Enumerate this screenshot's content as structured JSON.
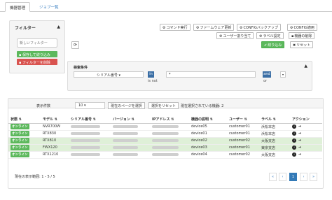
{
  "tabs": [
    {
      "label": "機器管理"
    },
    {
      "label": "ジョブ一覧"
    }
  ],
  "filter": {
    "title": "フィルター",
    "caret": "▲",
    "new_filter_placeholder": "新しいフィルター",
    "save_label": "保存して絞り込み",
    "delete_label": "フィルターを削除"
  },
  "toolbar": {
    "command": "コマンド実行",
    "firmware": "ファームウェア更新",
    "config_backup": "CONFIGバックアップ",
    "config_apply": "CONFIG適用",
    "user_assign": "ユーザー割り当て",
    "label_settings": "ラベル設定",
    "delete_device": "機器の削除",
    "narrow": "絞り込み",
    "reset": "リセット",
    "refresh_icon": "⟳"
  },
  "search": {
    "title": "検索条件",
    "caret": "▲",
    "field": "シリアル番号 ▾",
    "op_in": "in",
    "op_isnot": "is not",
    "value": "*",
    "and_label": "and",
    "or_label": "or",
    "dropdown": "▾"
  },
  "list": {
    "per_page_label": "表示件数",
    "per_page_value": "10 ▾",
    "select_page": "現在のページを選択",
    "reset_selection": "選択をリセット",
    "selected_count": "現在選択されている機器: 2",
    "columns": [
      "状態 ⇅",
      "モデル ⇅",
      "シリアル番号 ⇅",
      "バージョン ⇅",
      "IPアドレス ⇅",
      "機器の説明 ⇅",
      "ユーザー ⇅",
      "ラベル ⇅",
      "アクション"
    ],
    "rows": [
      {
        "status": "オンライン",
        "model": "NVR700W",
        "description": "device05",
        "user": "customer01",
        "label": "浜松本店",
        "selected": false
      },
      {
        "status": "オンライン",
        "model": "RTX830",
        "description": "device01",
        "user": "customer01",
        "label": "浜松本店",
        "selected": false
      },
      {
        "status": "オンライン",
        "model": "RTX810",
        "description": "device02",
        "user": "customer02",
        "label": "大阪支店",
        "selected": true
      },
      {
        "status": "オンライン",
        "model": "FWX120",
        "description": "device03",
        "user": "customer01",
        "label": "東京支店",
        "selected": true
      },
      {
        "status": "オンライン",
        "model": "RTX1210",
        "description": "device04",
        "user": "customer02",
        "label": "大阪支店",
        "selected": false
      }
    ],
    "range_text": "現在の表示範囲: 1 - 5 / 5",
    "pagination": [
      "«",
      "‹",
      "1",
      "›",
      "»"
    ],
    "current_page": "1"
  },
  "colors": {
    "online_badge": "#5cb85c",
    "selected_row": "#dff0d8",
    "primary": "#337ab7",
    "danger": "#d9534f"
  }
}
